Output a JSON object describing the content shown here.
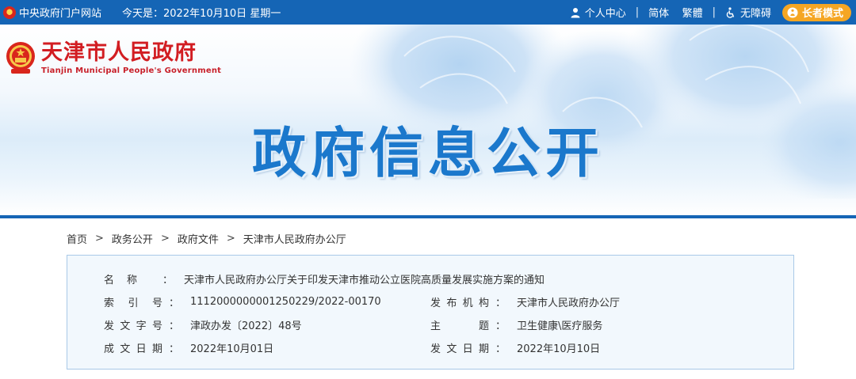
{
  "topbar": {
    "portal_link": "中央政府门户网站",
    "date_text": "今天是：2022年10月10日 星期一",
    "user_center": "个人中心",
    "simplified": "简体",
    "traditional": "繁體",
    "accessibility": "无障碍",
    "elder_mode": "长者模式",
    "separator": "|"
  },
  "header": {
    "city_cn": "天津市人民政府",
    "city_en": "Tianjin Municipal People's Government",
    "banner_title": "政府信息公开"
  },
  "breadcrumb": {
    "items": [
      "首页",
      "政务公开",
      "政府文件",
      "天津市人民政府办公厅"
    ],
    "arrow": ">"
  },
  "info": {
    "name_label": "名称",
    "name_value": "天津市人民政府办公厅关于印发天津市推动公立医院高质量发展实施方案的通知",
    "index_label": "索引号",
    "index_value": "1112000000001250229/2022-00170",
    "issuer_label": "发布机构",
    "issuer_value": "天津市人民政府办公厅",
    "docno_label": "发文字号",
    "docno_value": "津政办发〔2022〕48号",
    "subject_label": "主题",
    "subject_value": "卫生健康\\医疗服务",
    "created_label": "成文日期",
    "created_value": "2022年10月01日",
    "published_label": "发文日期",
    "published_value": "2022年10月10日",
    "colon": "："
  },
  "colors": {
    "topbar_bg": "#1565b5",
    "elder_button": "#f5a623",
    "city_red": "#d21d22",
    "title_blue": "#1b78cc",
    "box_border": "#a9c9e8",
    "box_bg": "#f2f8fd"
  },
  "icons": [
    "emblem-icon",
    "user-icon",
    "accessibility-icon",
    "elder-icon"
  ]
}
